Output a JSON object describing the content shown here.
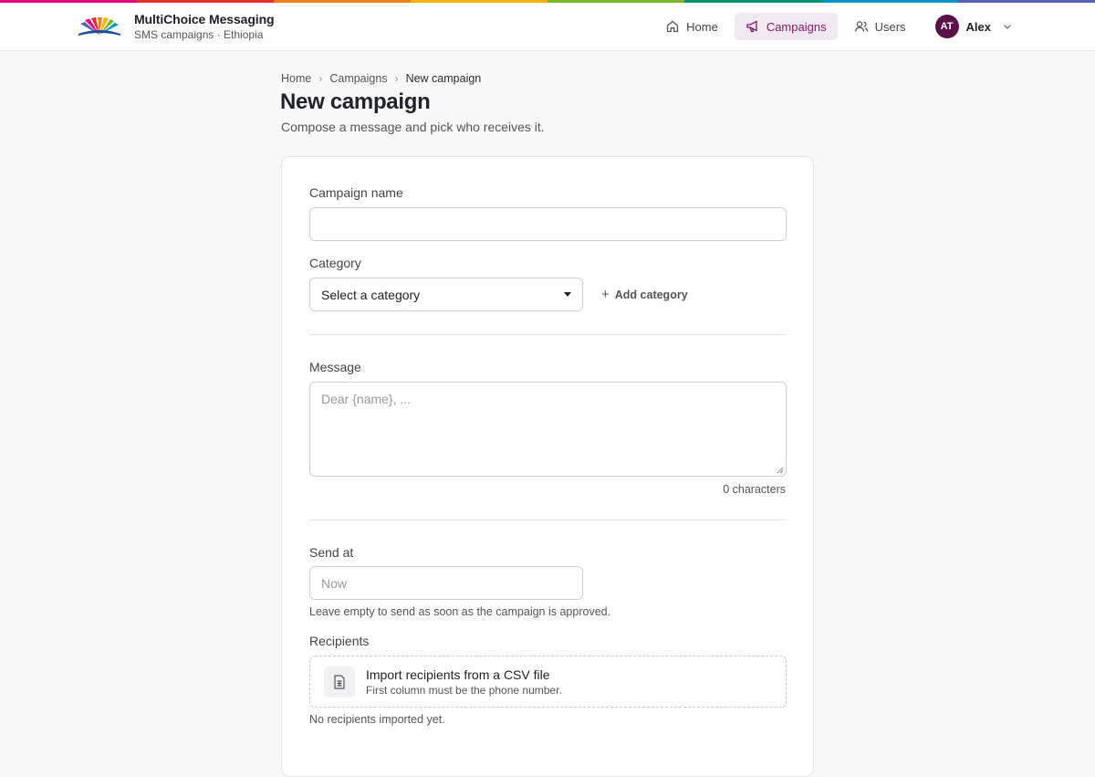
{
  "brand": {
    "title": "MultiChoice Messaging",
    "subtitle": "SMS campaigns · Ethiopia",
    "stripe_colors": [
      "#e5007e",
      "#e4322b",
      "#f07f1c",
      "#f6b400",
      "#7ab72d",
      "#00936e",
      "#0096c8",
      "#5b5fb3"
    ]
  },
  "nav": {
    "home": "Home",
    "campaigns": "Campaigns",
    "users": "Users",
    "active": "Campaigns",
    "active_color": "#7b1a66"
  },
  "user": {
    "initials": "AT",
    "name": "Alex"
  },
  "breadcrumb": {
    "home": "Home",
    "campaigns": "Campaigns",
    "current": "New campaign"
  },
  "page": {
    "title": "New campaign",
    "subtitle": "Compose a message and pick who receives it."
  },
  "form": {
    "campaign_name_label": "Campaign name",
    "campaign_name_value": "",
    "category_label": "Category",
    "category_selected": "Select a category",
    "add_category": "Add category",
    "message_label": "Message",
    "message_placeholder": "Dear {name}, ...",
    "message_counter": "0 characters",
    "send_at_label": "Send at",
    "send_at_placeholder": "Now",
    "send_at_hint": "Leave empty to send as soon as the campaign is approved.",
    "recipients_label": "Recipients",
    "import_title": "Import recipients from a CSV file",
    "import_sub": "First column must be the phone number.",
    "recipients_status": "No recipients imported yet."
  }
}
